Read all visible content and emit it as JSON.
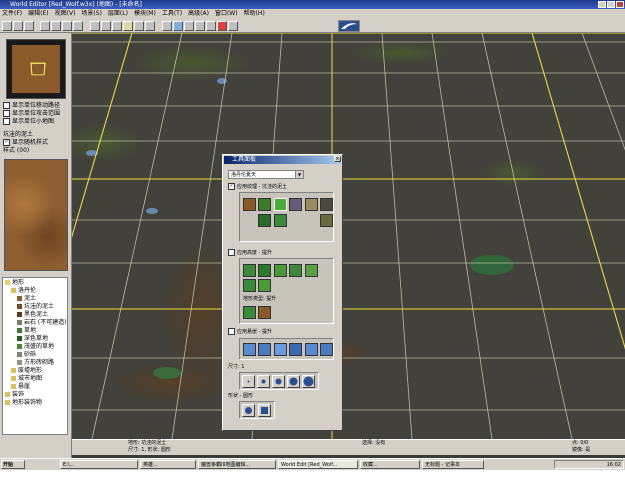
{
  "window": {
    "title": "World Editor [Red_Wolf.w3x] (地图) - [未命名]",
    "brand_color": "#1e3a8a"
  },
  "menu": {
    "items": [
      "文件(F)",
      "编辑(E)",
      "视图(V)",
      "场景(S)",
      "层面(L)",
      "模块(M)",
      "工具(T)",
      "高级(A)",
      "窗口(W)",
      "帮助(H)"
    ]
  },
  "left_panel": {
    "checkbox1_label": "显示单位移动路径",
    "checkbox2_label": "显示单位攻击范围",
    "checkbox3_label": "显示单位小地图",
    "brush_name": "坑洼的泥土",
    "random_variation_label": "显示随机样式",
    "variation_label": "样式 (00)"
  },
  "tree": {
    "root": "地形",
    "items": [
      {
        "label": "洛丹伦",
        "indent": 1,
        "color": "#d8c060"
      },
      {
        "label": "泥土",
        "indent": 2,
        "color": "#8a5a2a"
      },
      {
        "label": "坑洼的泥土",
        "indent": 2,
        "color": "#7a4a20"
      },
      {
        "label": "黑色泥土",
        "indent": 2,
        "color": "#5a3a1a"
      },
      {
        "label": "岩石 (不可建造)",
        "indent": 2,
        "color": "#7a7a70"
      },
      {
        "label": "草地",
        "indent": 2,
        "color": "#3a7a2a"
      },
      {
        "label": "深色草地",
        "indent": 2,
        "color": "#2a5a1a"
      },
      {
        "label": "茂盛的草地",
        "indent": 2,
        "color": "#4a8a2a"
      },
      {
        "label": "砂砾",
        "indent": 2,
        "color": "#8a8070"
      },
      {
        "label": "方形砖砌路",
        "indent": 2,
        "color": "#9a9080"
      },
      {
        "label": "废墟地形",
        "indent": 1,
        "color": "#d8c060"
      },
      {
        "label": "城市地图",
        "indent": 1,
        "color": "#d8c060"
      },
      {
        "label": "悬崖",
        "indent": 1,
        "color": "#d8c060"
      },
      {
        "label": "装饰",
        "indent": 0,
        "color": "#d8c060"
      },
      {
        "label": "地形装饰物",
        "indent": 0,
        "color": "#d8c060"
      }
    ]
  },
  "palette": {
    "title": "工具面板",
    "tileset_select": "洛丹伦夏天",
    "apply_texture_label": "应用纹理 - 坑洼的泥土",
    "apply_height_label": "应用高度 - 提升",
    "height_sub_label": "地形类型: 提升",
    "apply_cliff_label": "应用悬崖 - 提升",
    "size_label": "尺寸: 1",
    "shape_label": "形状 - 圆形",
    "shape_circle": "圆形",
    "shape_square": "方形"
  },
  "statusbar": {
    "line1_left": "地形: 坑洼的泥土",
    "line1_mid": "选择: 没有",
    "line1_right": "点: 0/0",
    "line2_left": "尺寸: 1, 形状: 圆形",
    "line2_right": "镜像: 是"
  },
  "taskbar": {
    "start": "开始",
    "tasks": [
      "E:\\...",
      "英雄...",
      "魔兽争霸III地图编辑...",
      "World Edit [Red_Wolf...",
      "收藏...",
      "无标题 - 记事本"
    ],
    "clock": "16:02"
  }
}
